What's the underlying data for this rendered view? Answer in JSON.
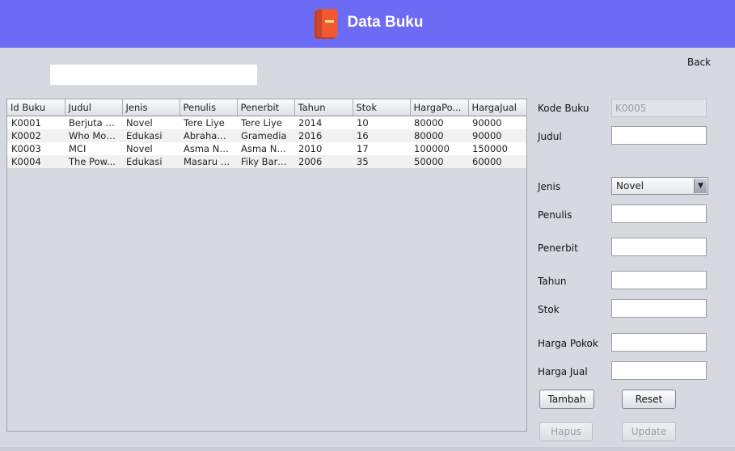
{
  "header": {
    "title": "Data Buku",
    "icon": "book-icon"
  },
  "search": {
    "value": "",
    "placeholder": ""
  },
  "back_label": "Back",
  "table": {
    "columns": [
      "Id Buku",
      "Judul",
      "Jenis",
      "Penulis",
      "Penerbit",
      "Tahun",
      "Stok",
      "HargaPo...",
      "HargaJual"
    ],
    "rows": [
      [
        "K0001",
        "Berjuta R...",
        "Novel",
        "Tere Liye",
        "Tere Liye",
        "2014",
        "10",
        "80000",
        "90000"
      ],
      [
        "K0002",
        "Who Mov...",
        "Edukasi",
        "Abraham...",
        "Gramedia",
        "2016",
        "16",
        "80000",
        "90000"
      ],
      [
        "K0003",
        "MCI",
        "Novel",
        "Asma Na...",
        "Asma Na...",
        "2010",
        "17",
        "100000",
        "150000"
      ],
      [
        "K0004",
        "The Pow...",
        "Edukasi",
        "Masaru E...",
        "Fiky Baro...",
        "2006",
        "35",
        "50000",
        "60000"
      ]
    ]
  },
  "form": {
    "kode_label": "Kode Buku",
    "kode_value": "K0005",
    "judul_label": "Judul",
    "judul_value": "",
    "jenis_label": "Jenis",
    "jenis_value": "Novel",
    "penulis_label": "Penulis",
    "penulis_value": "",
    "penerbit_label": "Penerbit",
    "penerbit_value": "",
    "tahun_label": "Tahun",
    "tahun_value": "",
    "stok_label": "Stok",
    "stok_value": "",
    "harga_pokok_label": "Harga Pokok",
    "harga_pokok_value": "",
    "harga_jual_label": "Harga Jual",
    "harga_jual_value": ""
  },
  "buttons": {
    "tambah": "Tambah",
    "reset": "Reset",
    "hapus": "Hapus",
    "update": "Update"
  },
  "colors": {
    "header_bg": "#6b6bf5",
    "body_bg": "#d6d9df"
  }
}
